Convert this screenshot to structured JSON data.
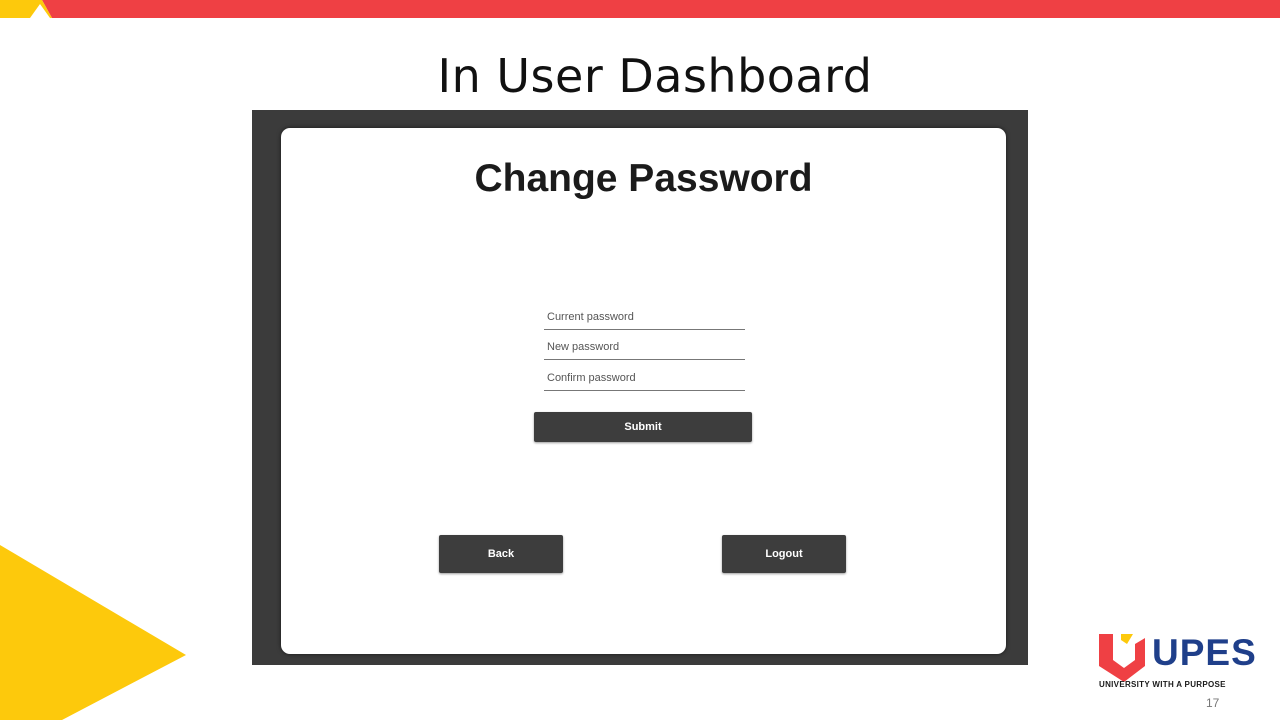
{
  "slide": {
    "title": "In User Dashboard",
    "page_number": "17"
  },
  "brand": {
    "name": "UPES",
    "tagline": "UNIVERSITY WITH A PURPOSE",
    "colors": {
      "red": "#ef4044",
      "yellow": "#fdc90c",
      "blue": "#1f3f8a"
    }
  },
  "form": {
    "title": "Change Password",
    "fields": [
      {
        "placeholder": "Current password",
        "value": ""
      },
      {
        "placeholder": "New password",
        "value": ""
      },
      {
        "placeholder": "Confirm password",
        "value": ""
      }
    ],
    "submit_label": "Submit",
    "back_label": "Back",
    "logout_label": "Logout"
  }
}
